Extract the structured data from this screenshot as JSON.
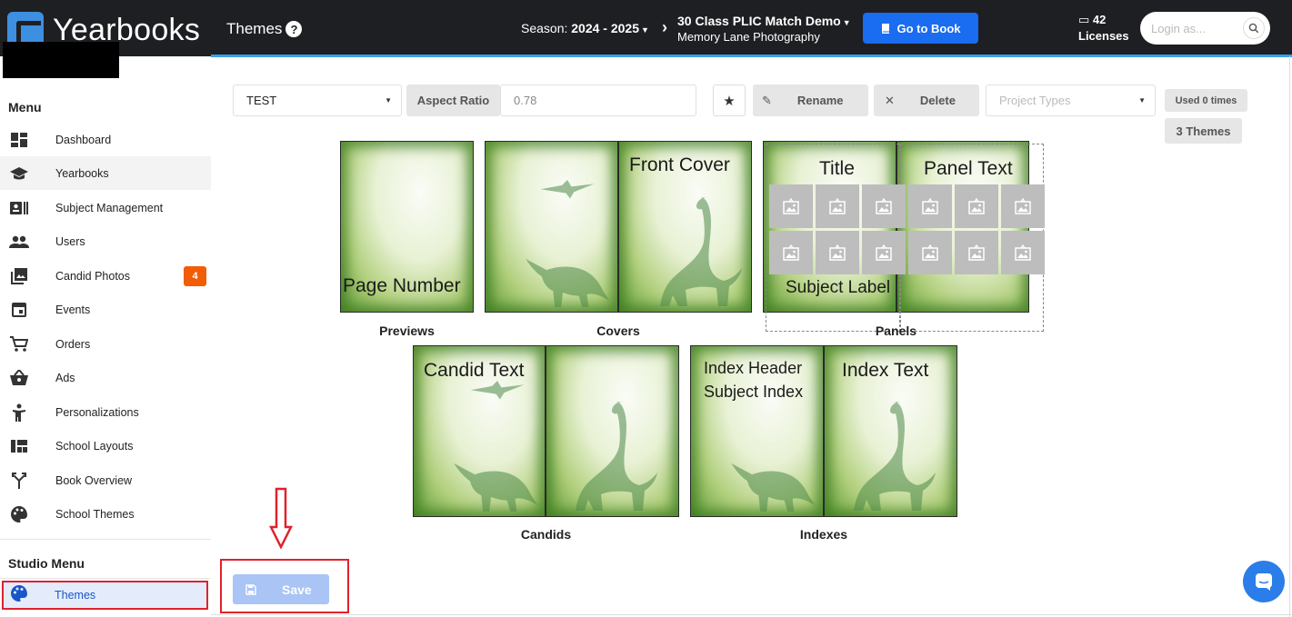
{
  "app": {
    "name": "Yearbooks"
  },
  "header": {
    "page_title": "Themes",
    "season_label": "Season:",
    "season_value": "2024 - 2025",
    "project_name": "30 Class PLIC Match Demo",
    "project_company": "Memory Lane Photography",
    "go_to_book": "Go to Book",
    "licenses_count": "42",
    "licenses_label": "Licenses",
    "login_placeholder": "Login as..."
  },
  "sidebar": {
    "menu_title": "Menu",
    "items": [
      {
        "label": "Dashboard",
        "icon": "dashboard-icon"
      },
      {
        "label": "Yearbooks",
        "icon": "graduation-cap-icon"
      },
      {
        "label": "Subject Management",
        "icon": "id-card-icon"
      },
      {
        "label": "Users",
        "icon": "users-icon"
      },
      {
        "label": "Candid Photos",
        "icon": "photo-library-icon",
        "badge": "4"
      },
      {
        "label": "Events",
        "icon": "calendar-icon"
      },
      {
        "label": "Orders",
        "icon": "cart-icon"
      },
      {
        "label": "Ads",
        "icon": "basket-icon"
      },
      {
        "label": "Personalizations",
        "icon": "person-icon"
      },
      {
        "label": "School Layouts",
        "icon": "layout-icon"
      },
      {
        "label": "Book Overview",
        "icon": "merge-icon"
      },
      {
        "label": "School Themes",
        "icon": "palette-icon"
      }
    ],
    "studio_title": "Studio Menu",
    "studio_items": [
      {
        "label": "Themes",
        "icon": "palette-icon"
      }
    ]
  },
  "toolbar": {
    "theme_select_value": "TEST",
    "aspect_ratio_label": "Aspect Ratio",
    "aspect_ratio_value": "0.78",
    "rename_label": "Rename",
    "delete_label": "Delete",
    "project_types_placeholder": "Project Types",
    "used_times": "Used 0 times",
    "themes_count": "3 Themes"
  },
  "previews": {
    "previews_caption": "Previews",
    "covers_caption": "Covers",
    "panels_caption": "Panels",
    "candids_caption": "Candids",
    "indexes_caption": "Indexes",
    "page_number": "Page Number",
    "front_cover": "Front Cover",
    "title": "Title",
    "panel_text": "Panel Text",
    "subject_label": "Subject Label",
    "candid_text": "Candid Text",
    "index_header": "Index Header",
    "subject_index": "Subject Index",
    "index_text": "Index Text"
  },
  "actions": {
    "save_label": "Save"
  },
  "colors": {
    "accent": "#1a6cf0",
    "topbar": "#1e1f22",
    "badge": "#f25c05",
    "highlight": "#e0222e"
  }
}
